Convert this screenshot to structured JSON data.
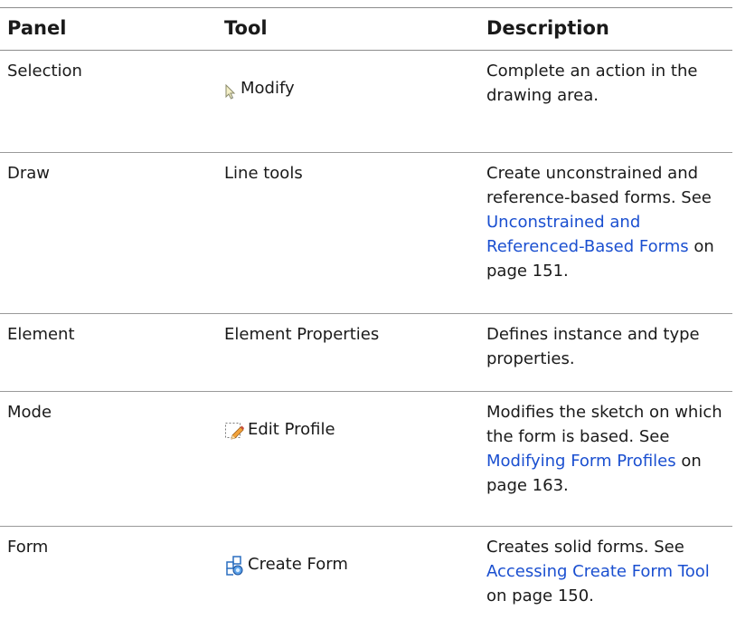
{
  "header": {
    "panel": "Panel",
    "tool": "Tool",
    "description": "Description"
  },
  "rows": [
    {
      "panel": "Selection",
      "tool": "Modify",
      "tool_icon": "cursor-arrow-icon",
      "description": "Complete an action in the drawing area."
    },
    {
      "panel": "Draw",
      "tool": "Line tools",
      "description_pre": "Create unconstrained and reference-based forms. See",
      "description_link": "Unconstrained and Referenced-Based Forms",
      "description_post": "on page 151."
    },
    {
      "panel": "Element",
      "tool": "Element Properties",
      "description": "Defines instance and type properties."
    },
    {
      "panel": "Mode",
      "tool": "Edit Profile",
      "tool_icon": "edit-profile-icon",
      "description_pre": "Modifies the sketch on which the form is based. See",
      "description_link": "Modifying Form Profiles",
      "description_post": "on page 163."
    },
    {
      "panel": "Form",
      "tool": "Create Form",
      "tool_icon": "create-form-icon",
      "description_pre": "Creates solid forms. See",
      "description_link": "Accessing Create Form Tool",
      "description_post": "on page 150."
    }
  ],
  "colors": {
    "link": "#1a4fd0",
    "rule": "#9a9a9a",
    "text": "#1a1a1a"
  }
}
